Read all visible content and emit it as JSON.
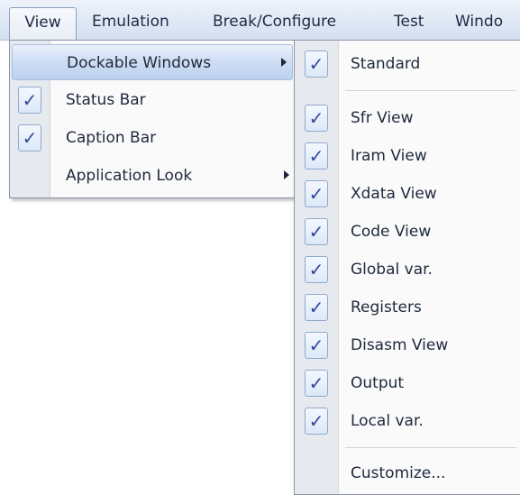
{
  "menubar": {
    "items": [
      "View",
      "Emulation",
      "Break/Configure",
      "Test",
      "Windo"
    ]
  },
  "view_menu": {
    "items": [
      {
        "label": "Dockable Windows",
        "checked": false,
        "submenu": true,
        "highlighted": true
      },
      {
        "label": "Status Bar",
        "checked": true,
        "submenu": false
      },
      {
        "label": "Caption Bar",
        "checked": true,
        "submenu": false
      },
      {
        "label": "Application Look",
        "checked": false,
        "submenu": true
      }
    ]
  },
  "dockable_submenu": {
    "items": [
      {
        "label": "Standard",
        "checked": true
      },
      {
        "label": "Sfr View",
        "checked": true
      },
      {
        "label": "Iram View",
        "checked": true
      },
      {
        "label": "Xdata View",
        "checked": true
      },
      {
        "label": "Code View",
        "checked": true
      },
      {
        "label": "Global var.",
        "checked": true
      },
      {
        "label": "Registers",
        "checked": true
      },
      {
        "label": "Disasm View",
        "checked": true
      },
      {
        "label": "Output",
        "checked": true
      },
      {
        "label": "Local var.",
        "checked": true
      },
      {
        "label": "Customize...",
        "checked": false
      }
    ]
  },
  "glyphs": {
    "check": "✓"
  },
  "colors": {
    "highlight": "#cfdef4",
    "check_fill": "#dce8f7",
    "check_mark": "#33479a"
  }
}
